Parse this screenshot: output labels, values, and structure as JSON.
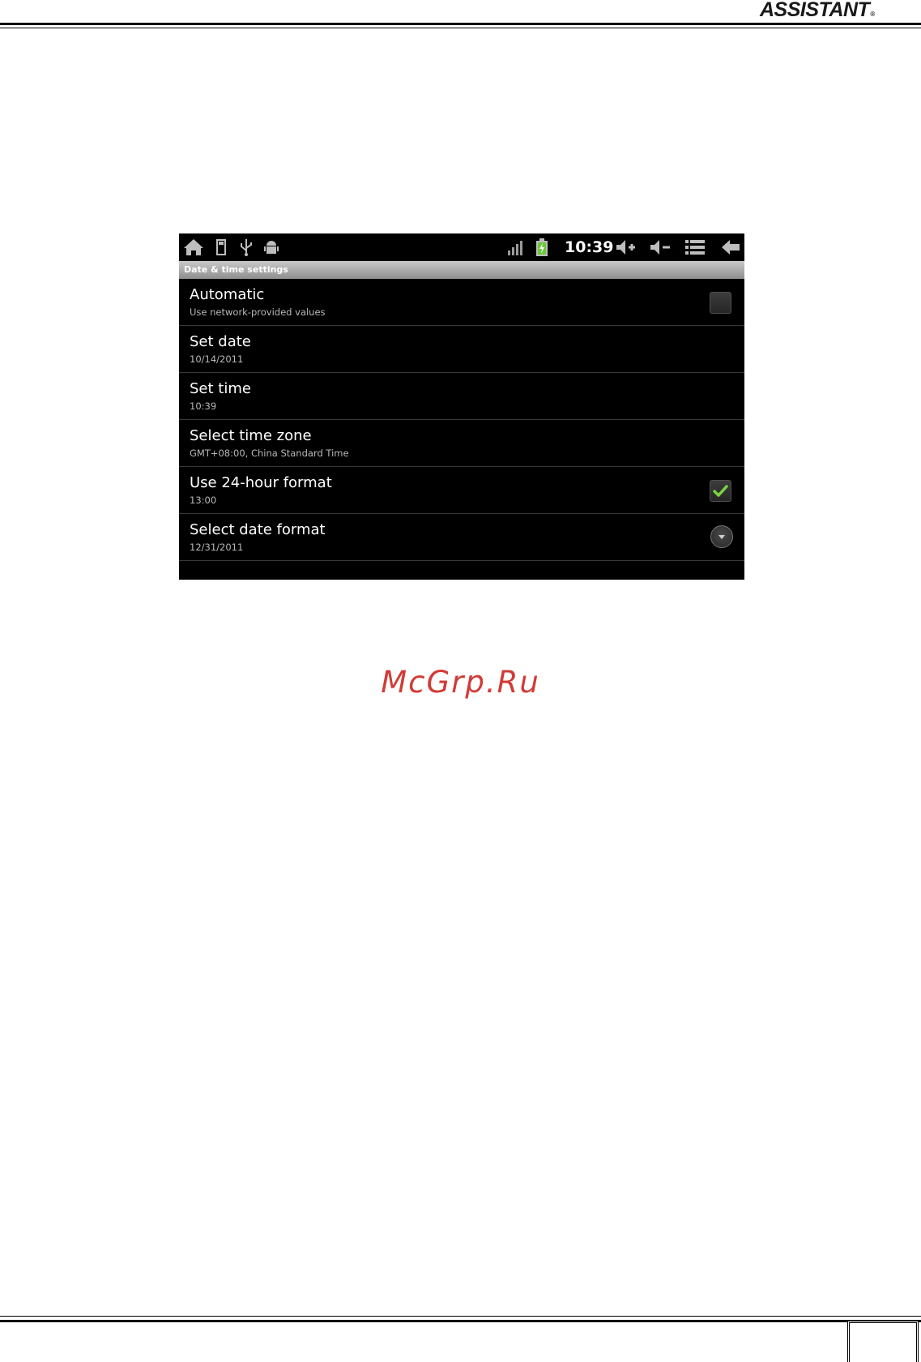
{
  "header": {
    "brand": "ASSISTANT",
    "reg_mark": "®"
  },
  "statusbar": {
    "time": "10:39",
    "colors": {
      "battery": "#6ac83a",
      "icons": "#bdbdbd"
    },
    "icons_left": [
      "home-icon",
      "sd-card-icon",
      "usb-icon",
      "android-debug-icon"
    ],
    "icons_right": [
      "signal-icon",
      "battery-charging-icon",
      "volume-up-icon",
      "volume-down-icon",
      "menu-icon",
      "back-icon"
    ]
  },
  "screen": {
    "title": "Date & time settings",
    "items": [
      {
        "title": "Automatic",
        "summary": "Use network-provided values",
        "widget": "checkbox",
        "checked": false
      },
      {
        "title": "Set date",
        "summary": "10/14/2011"
      },
      {
        "title": "Set time",
        "summary": "10:39"
      },
      {
        "title": "Select time zone",
        "summary": "GMT+08:00, China Standard Time"
      },
      {
        "title": "Use 24-hour format",
        "summary": "13:00",
        "widget": "checkbox",
        "checked": true
      },
      {
        "title": "Select date format",
        "summary": "12/31/2011",
        "widget": "dropdown"
      }
    ],
    "accent": "#7ad342"
  },
  "watermark": {
    "text": "McGrp.Ru",
    "color": "#d23b37"
  }
}
